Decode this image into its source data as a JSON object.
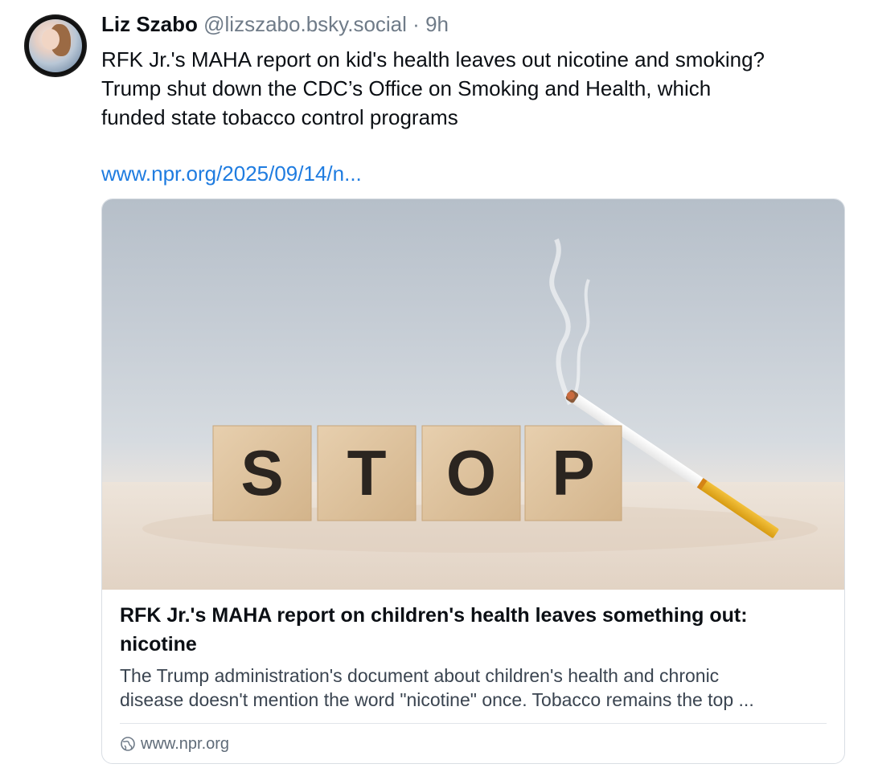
{
  "post": {
    "author_name": "Liz Szabo",
    "author_handle": "@lizszabo.bsky.social",
    "separator": "·",
    "timestamp": "9h",
    "text_lines": [
      "RFK Jr.'s MAHA report on kid's health leaves out nicotine and smoking?",
      "Trump shut down the CDC’s Office on Smoking and Health, which",
      "funded state tobacco control programs"
    ],
    "link_text": "www.npr.org/2025/09/14/n..."
  },
  "link_card": {
    "image_letters": [
      "S",
      "T",
      "O",
      "P"
    ],
    "title_lines": [
      "RFK Jr.'s MAHA report on children's health leaves something out:",
      "nicotine"
    ],
    "description_lines": [
      "The Trump administration's document about children's health and chronic",
      "disease doesn't mention the word \"nicotine\" once. Tobacco remains the top ..."
    ],
    "domain": "www.npr.org",
    "domain_icon": "globe-icon"
  },
  "colors": {
    "link": "#1f7ce0",
    "muted": "#6f7b88",
    "text": "#0b0f14",
    "border": "#d9dee4"
  }
}
